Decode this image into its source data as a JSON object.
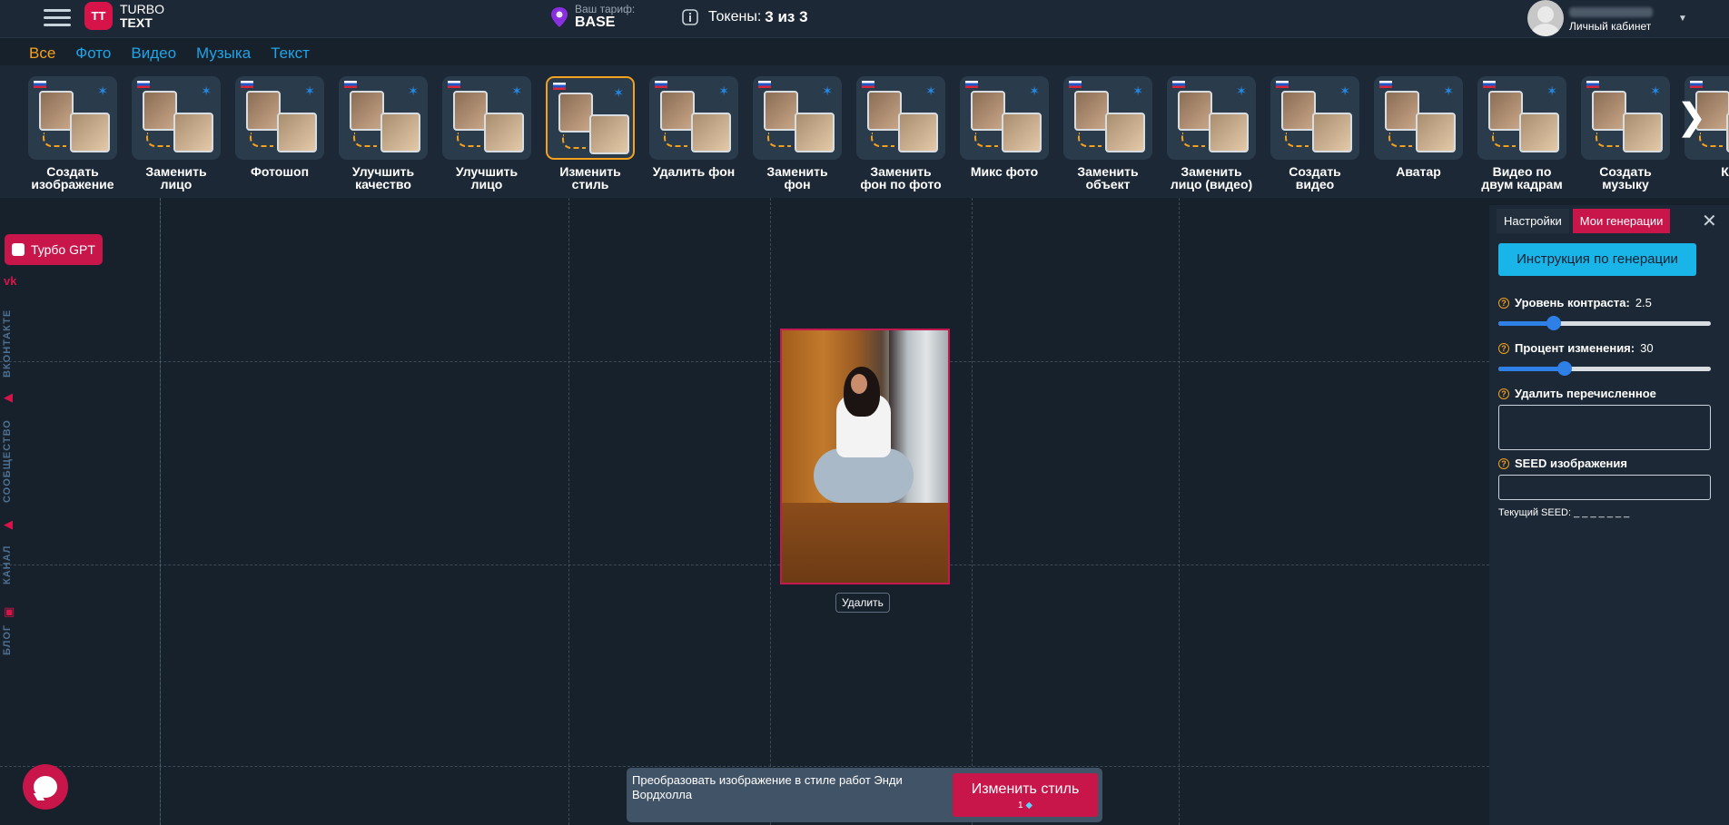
{
  "header": {
    "logo_badge": "TT",
    "logo_line1": "TURBO",
    "logo_line2": "TEXT",
    "plan_caption": "Ваш тариф:",
    "plan_name": "BASE",
    "tokens_label": "Токены:",
    "tokens_value": "3 из 3",
    "account_label": "Личный кабинет"
  },
  "categories": [
    "Все",
    "Фото",
    "Видео",
    "Музыка",
    "Текст"
  ],
  "tools": [
    {
      "label": "Создать изображение"
    },
    {
      "label": "Заменить лицо"
    },
    {
      "label": "Фотошоп"
    },
    {
      "label": "Улучшить качество"
    },
    {
      "label": "Улучшить лицо"
    },
    {
      "label": "Изменить стиль"
    },
    {
      "label": "Удалить фон"
    },
    {
      "label": "Заменить фон"
    },
    {
      "label": "Заменить фон по фото"
    },
    {
      "label": "Микс фото"
    },
    {
      "label": "Заменить объект"
    },
    {
      "label": "Заменить лицо (видео)"
    },
    {
      "label": "Создать видео"
    },
    {
      "label": "Аватар"
    },
    {
      "label": "Видео по двум кадрам"
    },
    {
      "label": "Создать музыку"
    },
    {
      "label": "Кл"
    }
  ],
  "canvas": {
    "delete_label": "Удалить"
  },
  "left_rail": {
    "gpt_label": "Турбо GPT",
    "items": [
      "ВКОНТАКТЕ",
      "СООБЩЕСТВО",
      "КАНАЛ",
      "БЛОГ"
    ]
  },
  "prompt": {
    "text": "Преобразовать изображение в стиле работ Энди Вордхолла",
    "button_label": "Изменить стиль",
    "cost": "1"
  },
  "panel": {
    "tab_settings": "Настройки",
    "tab_generations": "Мои генерации",
    "instruction_button": "Инструкция по генерации",
    "contrast_label": "Уровень контраста:",
    "contrast_value": "2.5",
    "contrast_fraction": 0.26,
    "change_label": "Процент изменения:",
    "change_value": "30",
    "change_fraction": 0.31,
    "remove_label": "Удалить перечисленное",
    "seed_label": "SEED изображения",
    "current_seed": "Текущий SEED: _ _ _ _ _ _ _"
  },
  "colors": {
    "accent": "#c8154a",
    "active_category": "#f5a11d",
    "link": "#21a3e6",
    "instruction": "#19b5e8"
  }
}
